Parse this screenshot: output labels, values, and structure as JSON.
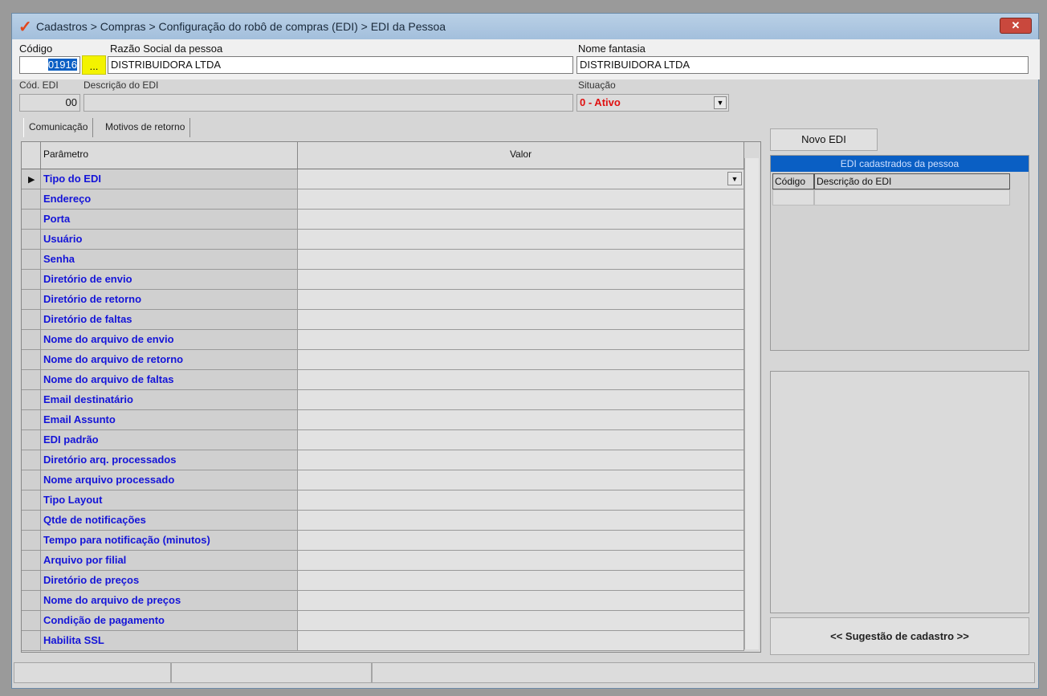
{
  "window": {
    "title": "Cadastros > Compras > Configuração do robô de compras (EDI) > EDI da Pessoa",
    "close": "✕"
  },
  "header": {
    "codigo_label": "Código",
    "codigo_value": "01916",
    "lookup_label": "...",
    "razao_label": "Razão Social da pessoa",
    "razao_value": "DISTRIBUIDORA LTDA",
    "fantasia_label": "Nome fantasia",
    "fantasia_value": "DISTRIBUIDORA LTDA",
    "cod_edi_label": "Cód. EDI",
    "cod_edi_value": "00",
    "desc_edi_label": "Descrição do EDI",
    "desc_edi_value": "",
    "situacao_label": "Situação",
    "situacao_value": "0 - Ativo"
  },
  "tabs": [
    "Comunicação",
    "Motivos de retorno"
  ],
  "grid": {
    "col_param": "Parâmetro",
    "col_valor": "Valor",
    "rows": [
      "Tipo do EDI",
      "Endereço",
      "Porta",
      "Usuário",
      "Senha",
      "Diretório de envio",
      "Diretório de retorno",
      "Diretório de faltas",
      "Nome do arquivo de envio",
      "Nome do arquivo de retorno",
      "Nome do arquivo de faltas",
      "Email destinatário",
      "Email Assunto",
      "EDI padrão",
      "Diretório arq. processados",
      "Nome arquivo processado",
      "Tipo Layout",
      "Qtde de notificações",
      "Tempo para notificação (minutos)",
      "Arquivo por filial",
      "Diretório de preços",
      "Nome do arquivo de preços",
      "Condição de pagamento",
      "Habilita SSL"
    ]
  },
  "side": {
    "novo_edi": "Novo EDI",
    "panel_title": "EDI cadastrados da pessoa",
    "col_codigo": "Código",
    "col_desc": "Descrição do EDI",
    "sugestao": "<< Sugestão de cadastro >>"
  },
  "colors": {
    "accent": "#0a5fc4",
    "param_text": "#1414d8",
    "situacao": "#e01010"
  }
}
